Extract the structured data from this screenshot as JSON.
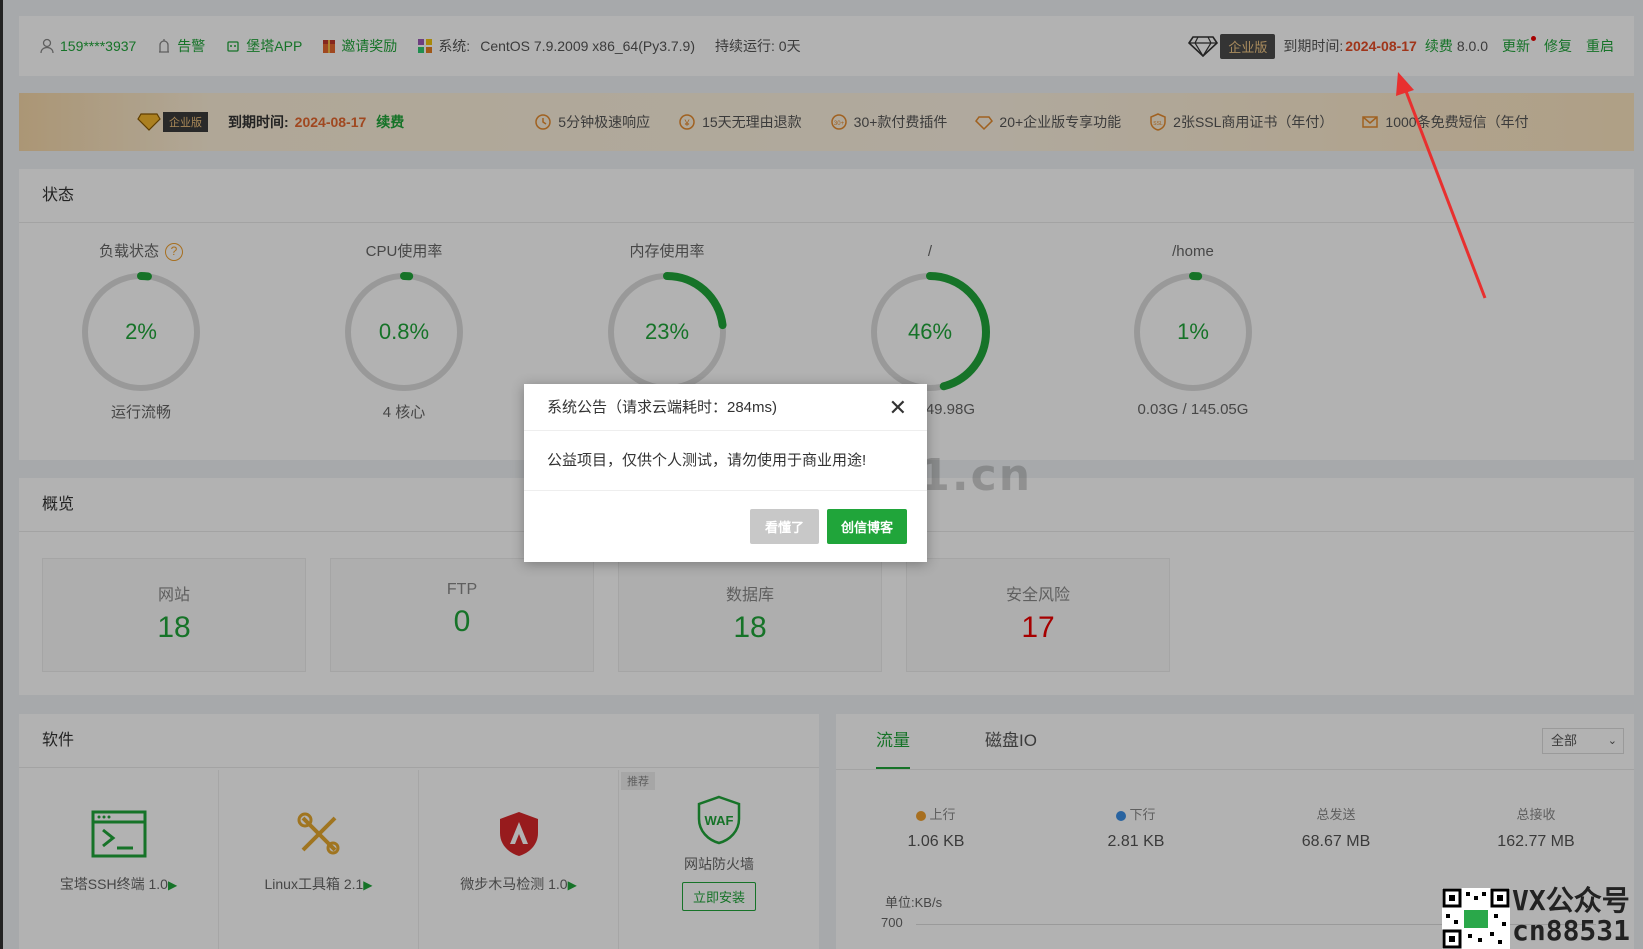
{
  "topbar": {
    "user": "159****3937",
    "alarm": "告警",
    "app": "堡塔APP",
    "invite": "邀请奖励",
    "system_label": "系统:",
    "system_value": "CentOS 7.9.2009 x86_64(Py3.7.9)",
    "uptime": "持续运行: 0天",
    "edition": "企业版",
    "expire_label": "到期时间:",
    "expire_date": "2024-08-17",
    "renew": "续费",
    "version": "8.0.0",
    "update": "更新",
    "repair": "修复",
    "restart": "重启"
  },
  "banner": {
    "edition": "企业版",
    "expire_label": "到期时间:",
    "expire_date": "2024-08-17",
    "renew": "续费",
    "features": [
      "5分钟极速响应",
      "15天无理由退款",
      "30+款付费插件",
      "20+企业版专享功能",
      "2张SSL商用证书（年付）",
      "1000条免费短信（年付"
    ]
  },
  "status": {
    "title": "状态",
    "gauges": [
      {
        "title": "负载状态",
        "value": "2%",
        "pct": 2,
        "sub": "运行流畅"
      },
      {
        "title": "CPU使用率",
        "value": "0.8%",
        "pct": 0.8,
        "sub": "4 核心"
      },
      {
        "title": "内存使用率",
        "value": "23%",
        "pct": 23,
        "sub": ""
      },
      {
        "title": "/",
        "value": "46%",
        "pct": 46,
        "sub": "69G / 49.98G"
      },
      {
        "title": "/home",
        "value": "1%",
        "pct": 1,
        "sub": "0.03G / 145.05G"
      }
    ]
  },
  "overview": {
    "title": "概览",
    "cards": [
      {
        "label": "网站",
        "value": "18"
      },
      {
        "label": "FTP",
        "value": "0"
      },
      {
        "label": "数据库",
        "value": "18"
      },
      {
        "label": "安全风险",
        "value": "17"
      }
    ]
  },
  "software": {
    "title": "软件",
    "items": [
      {
        "name": "宝塔SSH终端 1.0"
      },
      {
        "name": "Linux工具箱 2.1"
      },
      {
        "name": "微步木马检测 1.0"
      },
      {
        "name": "网站防火墙",
        "tag": "推荐",
        "button": "立即安装"
      }
    ],
    "triangle": "▶"
  },
  "traffic": {
    "tabs": [
      "流量",
      "磁盘IO"
    ],
    "select": "全部",
    "stats": [
      {
        "label": "上行",
        "value": "1.06 KB",
        "dot": "#f0a02e"
      },
      {
        "label": "下行",
        "value": "2.81 KB",
        "dot": "#3a8ee6"
      },
      {
        "label": "总发送",
        "value": "68.67 MB"
      },
      {
        "label": "总接收",
        "value": "162.77 MB"
      }
    ],
    "unit": "单位:KB/s",
    "y_top": "700"
  },
  "modal": {
    "title": "系统公告（请求云端耗时：284ms)",
    "body": "公益项目，仅供个人测试，请勿使用于商业用途!",
    "btn_ok": "看懂了",
    "btn_blog": "创信博客"
  },
  "watermark": "www.88531.cn",
  "vx": {
    "line1": "VX公众号",
    "line2": "cn88531"
  },
  "colors": {
    "accent": "#20a53a",
    "danger": "#e00000",
    "warning": "#f0a02e"
  }
}
